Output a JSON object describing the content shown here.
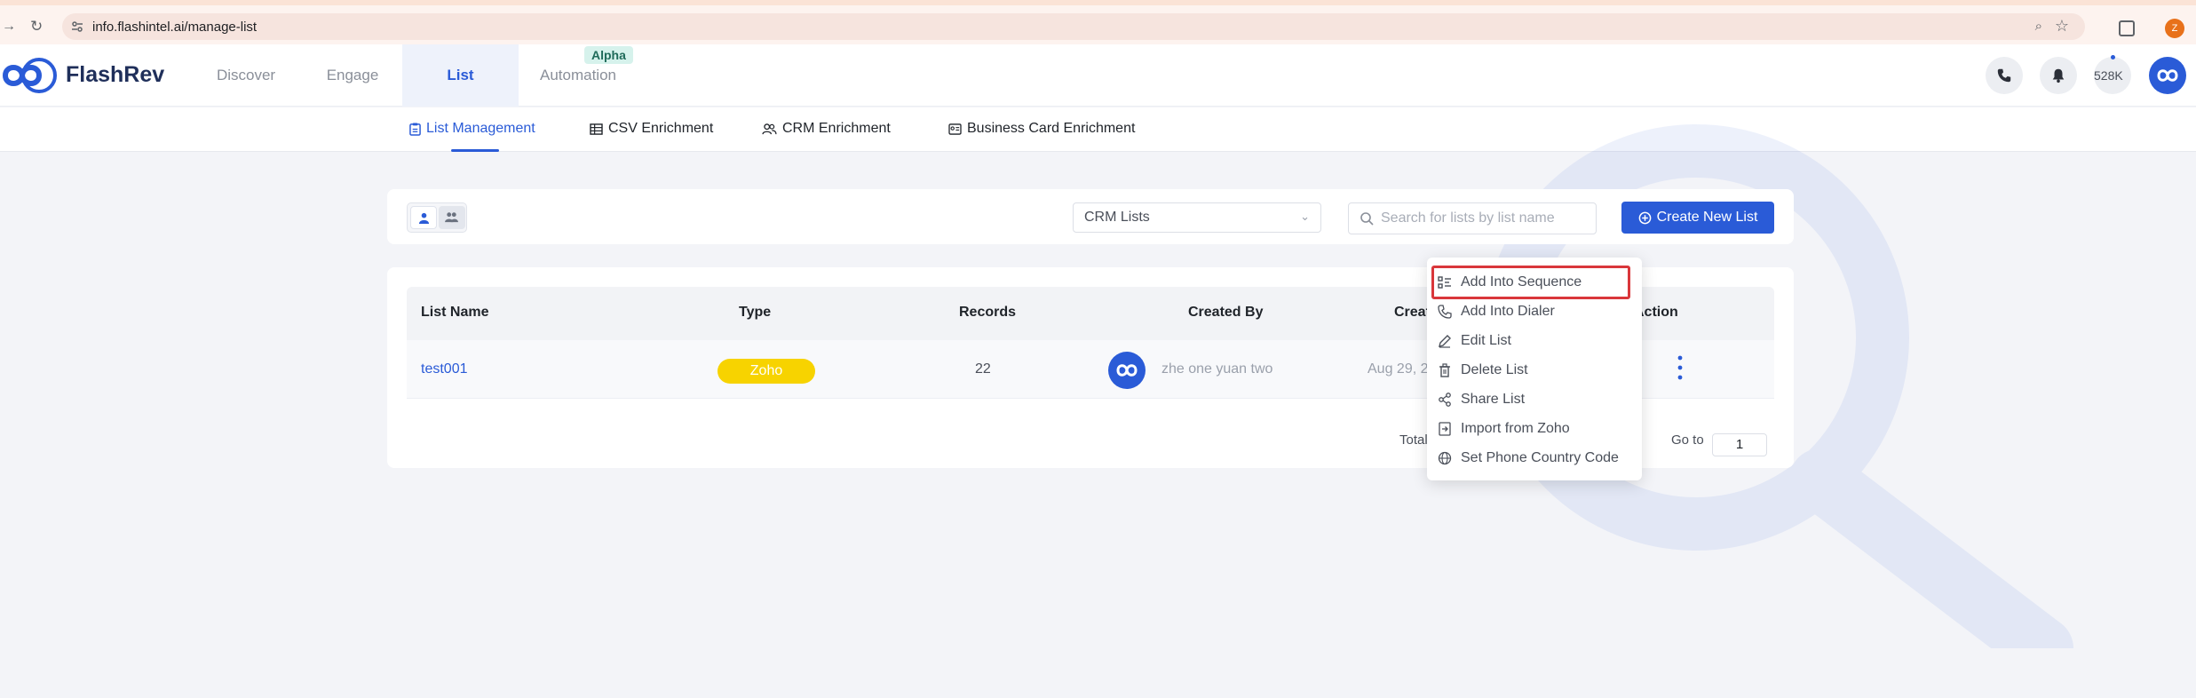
{
  "browser": {
    "url": "info.flashintel.ai/manage-list",
    "profile_initial": "Z"
  },
  "app": {
    "logo_text": "FlashRev",
    "nav": [
      {
        "label": "Discover"
      },
      {
        "label": "Engage"
      },
      {
        "label": "List",
        "active": true
      },
      {
        "label": "Automation",
        "badge": "Alpha"
      }
    ],
    "credits": "528K"
  },
  "subnav": {
    "tabs": [
      {
        "label": "List Management",
        "active": true
      },
      {
        "label": "CSV Enrichment"
      },
      {
        "label": "CRM Enrichment"
      },
      {
        "label": "Business Card Enrichment"
      }
    ]
  },
  "toolbar": {
    "list_type_select": "CRM Lists",
    "search_placeholder": "Search for lists by list name",
    "create_label": "Create New List"
  },
  "table": {
    "columns": [
      "List Name",
      "Type",
      "Records",
      "Created By",
      "Creat",
      "Action"
    ],
    "rows": [
      {
        "name": "test001",
        "type": "Zoho",
        "records": "22",
        "created_by": "zhe one yuan two",
        "created_at": "Aug 29, 2"
      }
    ],
    "footer": {
      "total_label": "Total",
      "goto_label": "Go to",
      "goto_value": "1"
    }
  },
  "menu": {
    "items": [
      {
        "label": "Add Into Sequence",
        "icon": "sequence-icon",
        "highlighted": true
      },
      {
        "label": "Add Into Dialer",
        "icon": "phone-icon"
      },
      {
        "label": "Edit List",
        "icon": "edit-icon"
      },
      {
        "label": "Delete List",
        "icon": "trash-icon"
      },
      {
        "label": "Share List",
        "icon": "share-icon"
      },
      {
        "label": "Import from Zoho",
        "icon": "import-icon"
      },
      {
        "label": "Set Phone Country Code",
        "icon": "globe-icon"
      }
    ]
  },
  "colors": {
    "accent": "#2a5bd7",
    "zoho_badge": "#f7d300",
    "highlight_border": "#d9373b"
  }
}
